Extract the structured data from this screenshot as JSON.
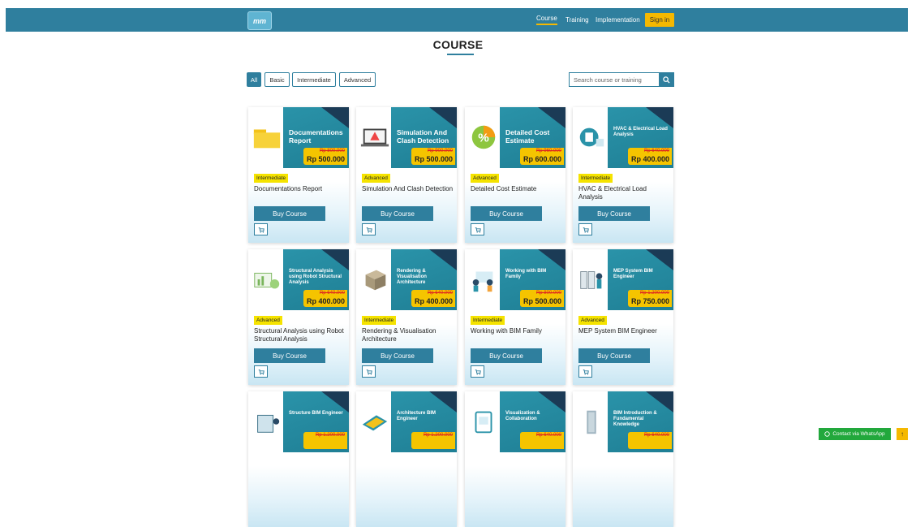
{
  "header": {
    "logo_text": "mm",
    "nav": [
      "Course",
      "Training",
      "Implementation"
    ],
    "signin": "Sign in"
  },
  "page_title": "COURSE",
  "filters": [
    "All",
    "Basic",
    "Intermediate",
    "Advanced"
  ],
  "search": {
    "placeholder": "Search course or training"
  },
  "courses": [
    {
      "banner": "Documentations Report",
      "old_price": "Rp 800.000",
      "price": "Rp 500.000",
      "level": "Intermediate",
      "name": "Documentations Report",
      "buy": "Buy Course",
      "icon": "folder-icon"
    },
    {
      "banner": "Simulation And Clash Detection",
      "old_price": "Rp 900.000",
      "price": "Rp 500.000",
      "level": "Advanced",
      "name": "Simulation And Clash Detection",
      "buy": "Buy Course",
      "icon": "laptop-warning-icon"
    },
    {
      "banner": "Detailed Cost Estimate",
      "old_price": "Rp 960.000",
      "price": "Rp 600.000",
      "level": "Advanced",
      "name": "Detailed Cost Estimate",
      "buy": "Buy Course",
      "icon": "percent-icon"
    },
    {
      "banner": "HVAC & Electrical Load Analysis",
      "old_price": "Rp 640.000",
      "price": "Rp 400.000",
      "level": "Intermediate",
      "name": "HVAC & Electrical Load Analysis",
      "buy": "Buy Course",
      "icon": "hvac-icon"
    },
    {
      "banner": "Structural Analysis using Robot Structural Analysis",
      "old_price": "Rp 640.000",
      "price": "Rp 400.000",
      "level": "Advanced",
      "name": "Structural Analysis using Robot Structural Analysis",
      "buy": "Buy Course",
      "icon": "structural-chart-icon"
    },
    {
      "banner": "Rendering & Visualisation Architecture",
      "old_price": "Rp 640.000",
      "price": "Rp 400.000",
      "level": "Intermediate",
      "name": "Rendering & Visualisation Architecture",
      "buy": "Buy Course",
      "icon": "building-block-icon"
    },
    {
      "banner": "Working with BIM Family",
      "old_price": "Rp 800.000",
      "price": "Rp 500.000",
      "level": "Intermediate",
      "name": "Working with BIM Family",
      "buy": "Buy Course",
      "icon": "team-icon"
    },
    {
      "banner": "MEP System BIM Engineer",
      "old_price": "Rp 1.200.000",
      "price": "Rp 750.000",
      "level": "Advanced",
      "name": "MEP System BIM Engineer",
      "buy": "Buy Course",
      "icon": "engineer-icon"
    },
    {
      "banner": "Structure BIM Engineer",
      "old_price": "Rp 1.200.000",
      "icon": "structure-engineer-icon"
    },
    {
      "banner": "Architecture BIM Engineer",
      "old_price": "Rp 1.200.000",
      "icon": "blueprint-icon"
    },
    {
      "banner": "Visualization & Collaboration",
      "old_price": "Rp 640.000",
      "icon": "tablet-icon"
    },
    {
      "banner": "BIM Introduction & Fundamental Knowledge",
      "old_price": "Rp 640.000",
      "icon": "tower-icon"
    }
  ],
  "floating": {
    "whatsapp": "Contact via WhatsApp",
    "top": "↑"
  },
  "colors": {
    "primary": "#2f7f9e",
    "accent": "#f5b800",
    "level_badge": "#f5e300",
    "whatsapp": "#22a83c"
  }
}
